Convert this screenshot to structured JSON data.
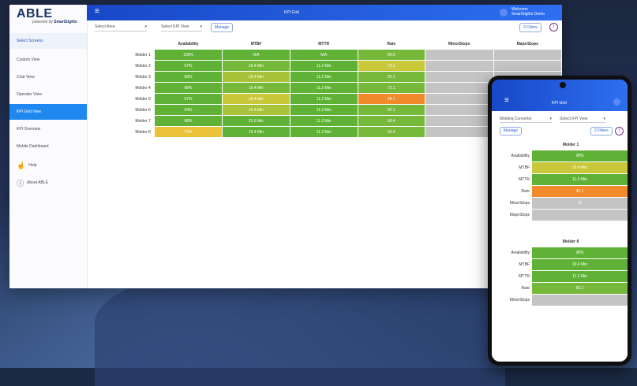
{
  "brand": {
    "logo_main": "ABLE",
    "logo_powered": "powered by",
    "logo_sub": "SmartSights"
  },
  "sidebar": {
    "items": [
      {
        "label": "Select Screens"
      },
      {
        "label": "Custom View"
      },
      {
        "label": "Chat View"
      },
      {
        "label": "Operator View"
      },
      {
        "label": "KPI Grid View"
      },
      {
        "label": "KPI Overview"
      },
      {
        "label": "Mobile Dashboard"
      },
      {
        "label": "Help"
      },
      {
        "label": "About ABLE"
      }
    ]
  },
  "topbar": {
    "title": "KPI Grid",
    "welcome_line1": "Welcome",
    "welcome_line2": "SmartSights Demo"
  },
  "toolbar": {
    "filter_value": "Select Area",
    "view_value": "Select KPI View",
    "manage_label": "Manage",
    "filters_label": "2 Filters"
  },
  "table": {
    "headers": [
      "Availability",
      "MTBF",
      "MTTR",
      "Rate",
      "MinorStops",
      "MajorStops"
    ],
    "rows": [
      {
        "label": "Molder 1",
        "cells": [
          "100%",
          "N/A",
          "N/A",
          "80.5",
          "",
          ""
        ]
      },
      {
        "label": "Molder 2",
        "cells": [
          "97%",
          "19.4 Min",
          "11.2 Min",
          "72.1",
          "",
          ""
        ]
      },
      {
        "label": "Molder 3",
        "cells": [
          "99%",
          "19.4 Min",
          "11.2 Min",
          "92.1",
          "",
          ""
        ]
      },
      {
        "label": "Molder 4",
        "cells": [
          "98%",
          "19.4 Min",
          "11.2 Min",
          "72.1",
          "",
          ""
        ]
      },
      {
        "label": "Molder 5",
        "cells": [
          "97%",
          "18.4 Min",
          "11.2 Min",
          "48.7",
          "",
          ""
        ]
      },
      {
        "label": "Molder 6",
        "cells": [
          "94%",
          "19.4 Min",
          "11.2 Min",
          "92.1",
          "",
          ""
        ]
      },
      {
        "label": "Molder 7",
        "cells": [
          "98%",
          "21.5 Min",
          "11.3 Min",
          "69.4",
          "",
          ""
        ]
      },
      {
        "label": "Molder 8",
        "cells": [
          "70%",
          "19.4 Min",
          "11.3 Min",
          "69.4",
          "",
          ""
        ]
      }
    ]
  },
  "phone": {
    "title": "KPI Grid",
    "area_value": "Molding Convertor",
    "view_value": "Select KPI View",
    "manage_label": "Manage",
    "filters_label": "2 Filters",
    "sections": [
      {
        "title": "Molder 1",
        "rows": [
          {
            "label": "Availability",
            "value": "98%"
          },
          {
            "label": "MTBF",
            "value": "19.4 Min"
          },
          {
            "label": "MTTR",
            "value": "11.3 Min"
          },
          {
            "label": "Rate",
            "value": "42.1"
          },
          {
            "label": "MinorStops",
            "value": "15"
          },
          {
            "label": "MajorStops",
            "value": ""
          }
        ]
      },
      {
        "title": "Molder 8",
        "rows": [
          {
            "label": "Availability",
            "value": "98%"
          },
          {
            "label": "MTBF",
            "value": "19.4 Min"
          },
          {
            "label": "MTTR",
            "value": "11.2 Min"
          },
          {
            "label": "Rate",
            "value": "92.1"
          },
          {
            "label": "MinorStops",
            "value": ""
          }
        ]
      }
    ]
  },
  "colors": {
    "good": "#5fb236",
    "fair": "#c8c83a",
    "warn": "#ecc23a",
    "bad": "#f08a2a",
    "none": "#c4c4c4",
    "accent": "#1e88f0"
  }
}
